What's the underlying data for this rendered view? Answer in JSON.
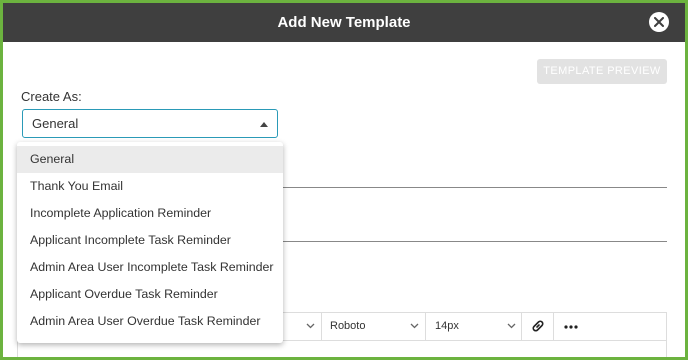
{
  "dialog": {
    "title": "Add New Template",
    "close_icon": "close-icon"
  },
  "preview_button": {
    "label": "TEMPLATE PREVIEW",
    "state": "disabled"
  },
  "create_as": {
    "label": "Create As:",
    "selected": "General",
    "options": [
      "General",
      "Thank You Email",
      "Incomplete Application Reminder",
      "Applicant Incomplete Task Reminder",
      "Admin Area User Incomplete Task Reminder",
      "Applicant Overdue Task Reminder",
      "Admin Area User Overdue Task Reminder"
    ]
  },
  "toolbar": {
    "font_family": "Roboto",
    "font_size": "14px",
    "link_icon": "link-icon",
    "more_icon": "more-icon"
  },
  "colors": {
    "frame_border": "#6cb33f",
    "titlebar": "#3f3f3f",
    "focus_border": "#2a9ab7",
    "disabled_button": "#e2e2e2",
    "highlight": "#ebebeb"
  }
}
